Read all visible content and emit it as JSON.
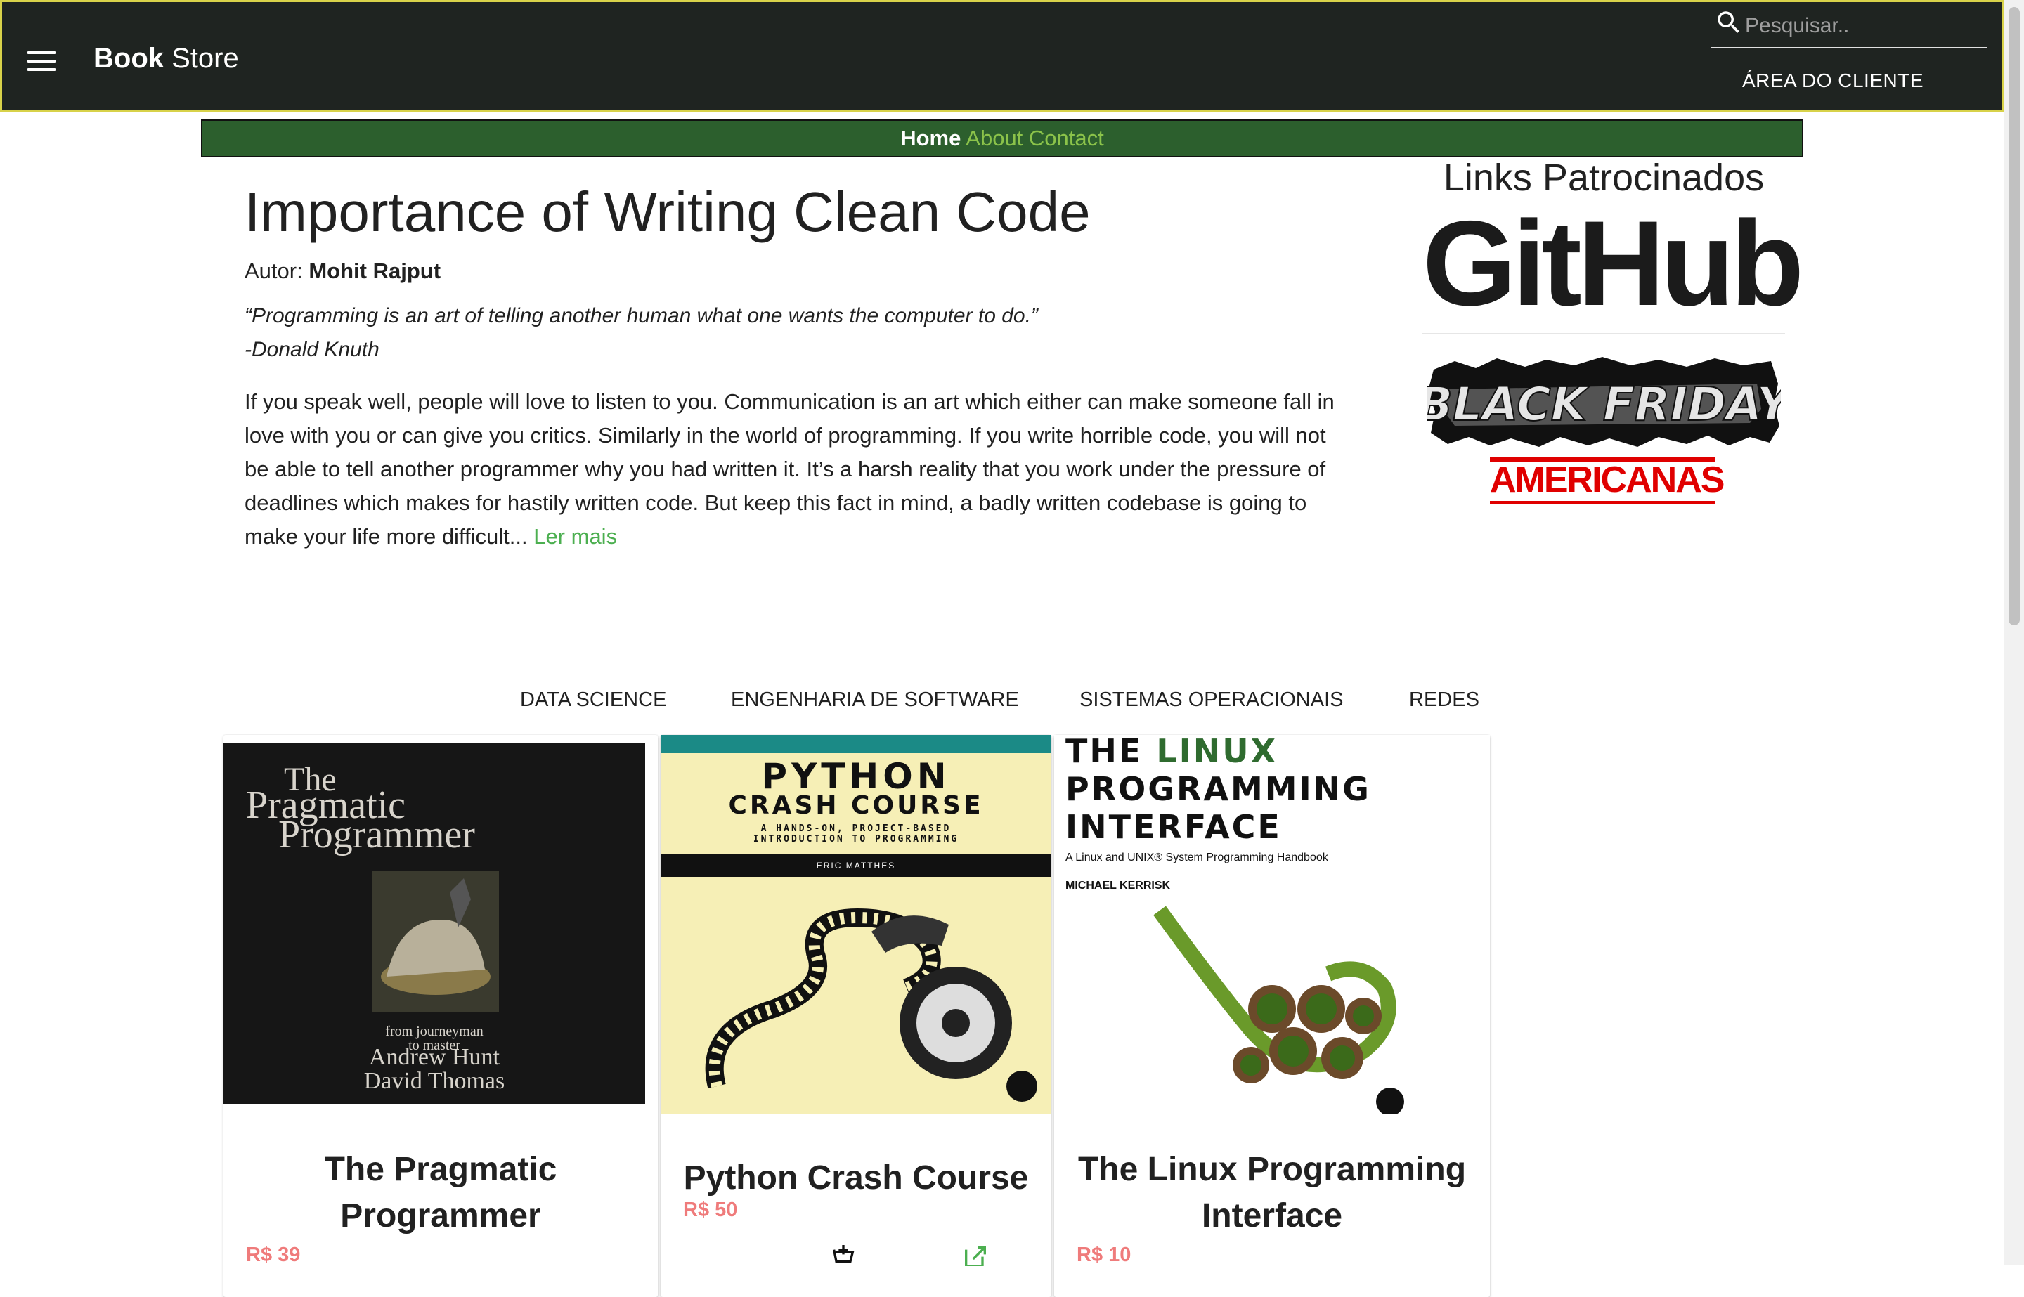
{
  "appbar": {
    "brand_bold": "Book",
    "brand_rest": " Store",
    "search_placeholder": "Pesquisar..",
    "client_area_label": "ÁREA DO CLIENTE"
  },
  "subnav": {
    "home": "Home",
    "about": "About",
    "contact": "Contact"
  },
  "article": {
    "title": "Importance of Writing Clean Code",
    "author_label": "Autor:",
    "author_name": "Mohit Rajput",
    "quote_text": "“Programming is an art of telling another human what one wants the computer to do.”",
    "quote_author": "-Donald Knuth",
    "body": "If you speak well, people will love to listen to you. Communication is an art which either can make someone fall in love with you or can give you critics. Similarly in the world of programming. If you write horrible code, you will not be able to tell another programmer why you had written it. It’s a harsh reality that you work under the pressure of deadlines which makes for hastily written code. But keep this fact in mind, a badly written codebase is going to make your life more difficult...",
    "read_more": "Ler mais"
  },
  "sponsored": {
    "title": "Links Patrocinados",
    "github": "GitHub",
    "black_friday": "BLACK FRIDAY",
    "americanas": "AMERICANAS"
  },
  "categories": [
    "DATA SCIENCE",
    "ENGENHARIA DE SOFTWARE",
    "SISTEMAS OPERACIONAIS",
    "REDES"
  ],
  "books": [
    {
      "title_line1": "The Pragmatic",
      "title_line2": "Programmer",
      "price": "R$ 39",
      "cover": {
        "line1": "The",
        "line2": "Pragmatic",
        "line3": "Programmer",
        "tag1": "from journeyman",
        "tag2": "to master",
        "author1": "Andrew Hunt",
        "author2": "David Thomas"
      }
    },
    {
      "title_line1": "Python Crash Course",
      "price": "R$ 50",
      "cover": {
        "line1": "PYTHON",
        "line2": "CRASH COURSE",
        "tag1": "A HANDS-ON, PROJECT-BASED",
        "tag2": "INTRODUCTION TO PROGRAMMING",
        "author": "ERIC MATTHES"
      }
    },
    {
      "title_line1": "The Linux Programming",
      "title_line2": "Interface",
      "price": "R$ 10",
      "cover": {
        "line1a": "THE ",
        "line1b": "LINUX",
        "line2": "PROGRAMMING",
        "line3": "INTERFACE",
        "sub": "A Linux and UNIX® System Programming Handbook",
        "author": "MICHAEL KERRISK"
      }
    }
  ],
  "colors": {
    "appbar_bg": "#1f2421",
    "appbar_border": "#d8d24a",
    "subnav_bg": "#2c5f2d",
    "link_green": "#8bc34a",
    "read_more_green": "#4caf50",
    "price_red": "#ef7b7b",
    "americanas_red": "#e00000"
  },
  "icons": [
    "menu-icon",
    "search-icon",
    "add-to-cart-icon",
    "external-link-icon"
  ]
}
